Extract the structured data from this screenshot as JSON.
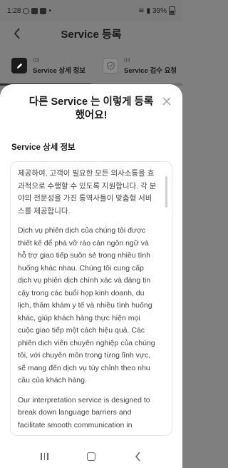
{
  "status_bar": {
    "time": "1:28",
    "battery": "39%"
  },
  "header": {
    "title": "Service 등록"
  },
  "steps": [
    {
      "number": "03",
      "label": "Service 상세 정보"
    },
    {
      "number": "04",
      "label": "Service 검수 요청"
    }
  ],
  "sheet": {
    "title": "다른 Service 는 이렇게 등록했어요!",
    "section_title": "Service 상세 정보",
    "paragraphs": [
      "제공하여, 고객이 필요한 모든 의사소통을 효과적으로 수행할 수 있도록 지원합니다. 각 분야의 전문성을 가진 통역사들이 맞춤형 서비스를 제공합니다.",
      "Dịch vụ phiên dịch của chúng tôi được thiết kế để phá vỡ rào cản ngôn ngữ và hỗ trợ giao tiếp suôn sẻ trong nhiều tình huống khác nhau. Chúng tôi cung cấp dịch vụ phiên dịch chính xác và đáng tin cậy trong các buổi họp kinh doanh, du lịch, thăm khám y tế và nhiều tình huống khác, giúp khách hàng thực hiện mọi cuộc giao tiếp một cách hiệu quả. Các phiên dịch viên chuyên nghiệp của chúng tôi, với chuyên môn trong từng lĩnh vực, sẽ mang đến dịch vụ tùy chỉnh theo nhu cầu của khách hàng.",
      "Our interpretation service is designed to break down language barriers and facilitate smooth communication in"
    ]
  },
  "icons": {
    "back": "chevron-left-icon",
    "close": "close-icon",
    "step_active": "pencil-icon",
    "step_inactive": "shield-check-icon"
  }
}
